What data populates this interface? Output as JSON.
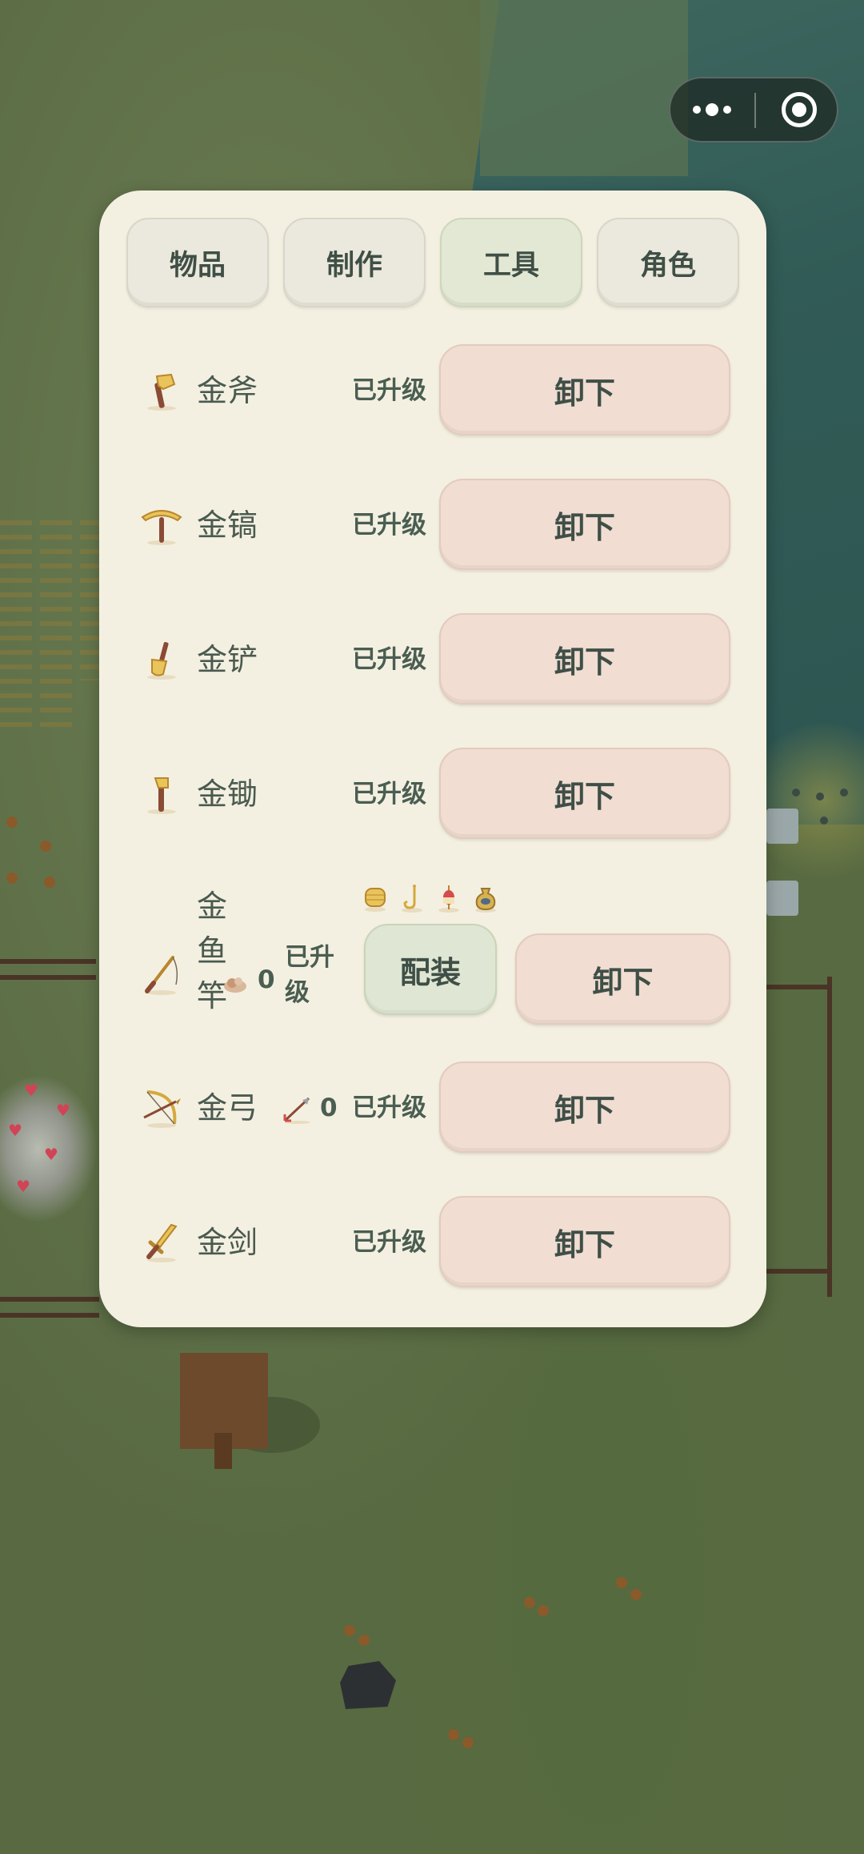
{
  "capsule": {
    "menu_icon": "more-dots-icon",
    "close_icon": "target-circle-icon"
  },
  "tabs": [
    {
      "label": "物品",
      "active": false
    },
    {
      "label": "制作",
      "active": false
    },
    {
      "label": "工具",
      "active": true
    },
    {
      "label": "角色",
      "active": false
    }
  ],
  "tools": [
    {
      "name": "金斧",
      "icon": "golden-axe-icon",
      "status": "已升级",
      "action": "卸下"
    },
    {
      "name": "金镐",
      "icon": "golden-pickaxe-icon",
      "status": "已升级",
      "action": "卸下"
    },
    {
      "name": "金铲",
      "icon": "golden-shovel-icon",
      "status": "已升级",
      "action": "卸下"
    },
    {
      "name": "金锄",
      "icon": "golden-hoe-icon",
      "status": "已升级",
      "action": "卸下"
    },
    {
      "name": "金鱼竿",
      "icon": "golden-fishing-rod-icon",
      "ammo_icon": "bait-icon",
      "ammo_count": "0",
      "status": "已升级",
      "equip_label": "配装",
      "action": "卸下",
      "accessories": [
        "fishing-line-icon",
        "hook-icon",
        "float-icon",
        "bait-bag-icon"
      ]
    },
    {
      "name": "金弓",
      "icon": "golden-bow-icon",
      "ammo_icon": "arrow-icon",
      "ammo_count": "0",
      "status": "已升级",
      "action": "卸下"
    },
    {
      "name": "金剑",
      "icon": "golden-sword-icon",
      "status": "已升级",
      "action": "卸下"
    }
  ],
  "colors": {
    "panel": "#f4f0e1",
    "unequip_button": "#f1ddd2",
    "equip_button": "#dfe6d3",
    "active_tab": "#e2e8d4"
  }
}
